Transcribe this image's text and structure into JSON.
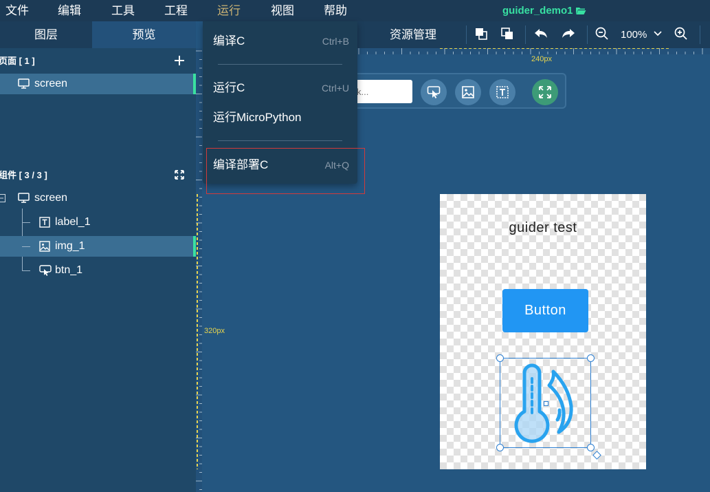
{
  "menu": {
    "items": [
      {
        "label": "文件"
      },
      {
        "label": "编辑"
      },
      {
        "label": "工具"
      },
      {
        "label": "工程"
      },
      {
        "label": "运行"
      },
      {
        "label": "视图"
      },
      {
        "label": "帮助"
      }
    ],
    "project_title": "guider_demo1"
  },
  "left_panel": {
    "tabs": [
      "图层",
      "预览"
    ],
    "pages_title": "页面 [ 1 ]",
    "pages": [
      {
        "label": "screen"
      }
    ],
    "widgets_title": "组件 [ 3 / 3 ]",
    "widgets": [
      {
        "label": "screen"
      },
      {
        "label": "label_1"
      },
      {
        "label": "img_1"
      },
      {
        "label": "btn_1"
      }
    ]
  },
  "toolbar": {
    "resource_tab": "资源管理",
    "zoom": "100%"
  },
  "rulers": {
    "top_label": "240px",
    "left_label": "320px"
  },
  "widget_toolbar": {
    "search_placeholder": "k..."
  },
  "screen_preview": {
    "label_text": "guider test",
    "button_text": "Button",
    "image_icon": "thermometer-humidity-icon",
    "accent": "#2196f3"
  },
  "run_menu": {
    "items": [
      {
        "label": "编译C",
        "shortcut": "Ctrl+B"
      },
      {
        "label": "运行C",
        "shortcut": "Ctrl+U"
      },
      {
        "label": "运行MicroPython",
        "shortcut": ""
      },
      {
        "label": "编译部署C",
        "shortcut": "Alt+Q"
      }
    ],
    "highlight_color": "#d23a3a"
  }
}
